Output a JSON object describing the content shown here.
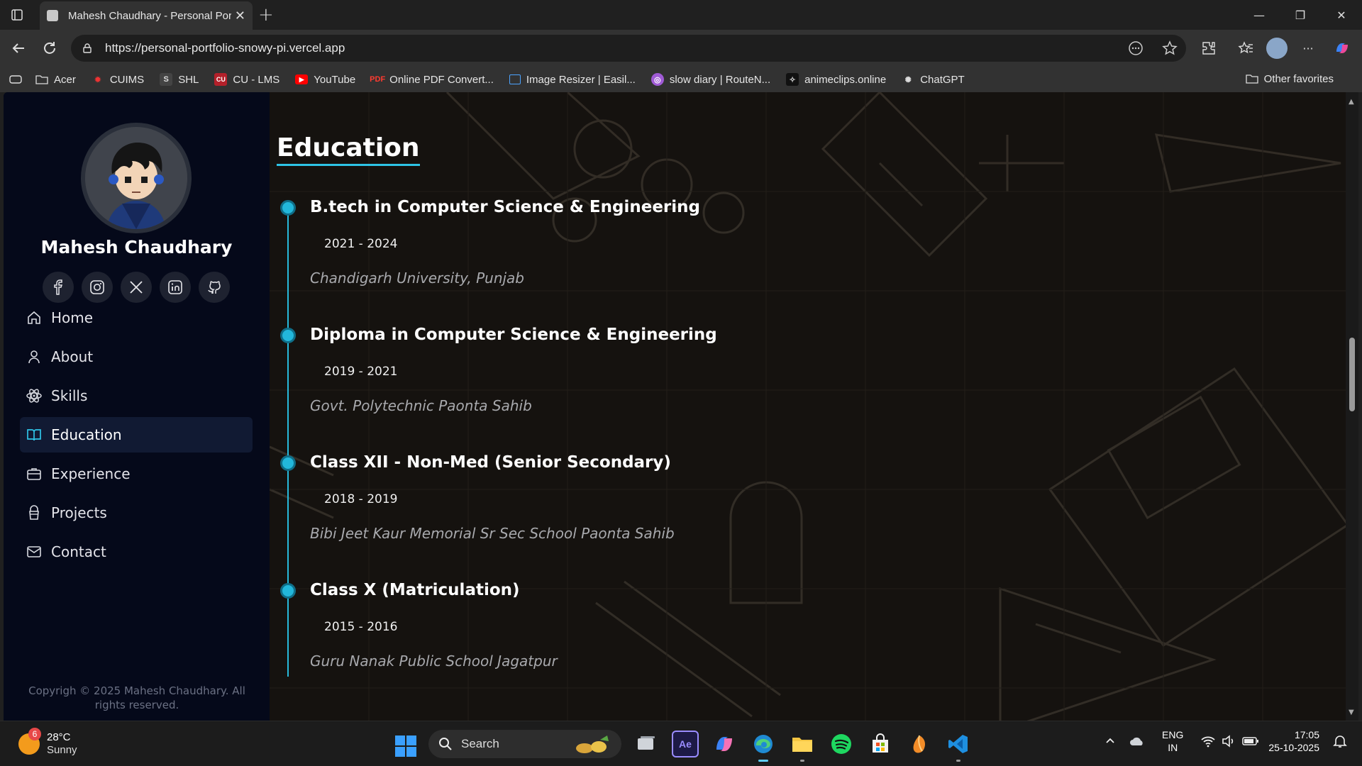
{
  "browser": {
    "tab_title": "Mahesh Chaudhary - Personal Portfolio",
    "url": "https://personal-portfolio-snowy-pi.vercel.app",
    "favorites": [
      {
        "label": "Acer",
        "icon": "folder-icon"
      },
      {
        "label": "CUIMS",
        "icon": "cuims-icon"
      },
      {
        "label": "SHL",
        "icon": "shl-icon"
      },
      {
        "label": "CU - LMS",
        "icon": "lms-icon"
      },
      {
        "label": "YouTube",
        "icon": "youtube-icon"
      },
      {
        "label": "Online PDF Convert...",
        "icon": "pdf-icon"
      },
      {
        "label": "Image Resizer | Easil...",
        "icon": "image-resizer-icon"
      },
      {
        "label": "slow diary | RouteN...",
        "icon": "routenote-icon"
      },
      {
        "label": "animeclips.online",
        "icon": "animeclips-icon"
      },
      {
        "label": "ChatGPT",
        "icon": "chatgpt-icon"
      }
    ],
    "other_favorites": "Other favorites"
  },
  "sidebar": {
    "name": "Mahesh Chaudhary",
    "socials": [
      "facebook-icon",
      "instagram-icon",
      "x-icon",
      "linkedin-icon",
      "github-icon"
    ],
    "nav": [
      {
        "label": "Home",
        "icon": "home-icon",
        "active": false
      },
      {
        "label": "About",
        "icon": "user-icon",
        "active": false
      },
      {
        "label": "Skills",
        "icon": "atom-icon",
        "active": false
      },
      {
        "label": "Education",
        "icon": "book-icon",
        "active": true
      },
      {
        "label": "Experience",
        "icon": "briefcase-icon",
        "active": false
      },
      {
        "label": "Projects",
        "icon": "projects-icon",
        "active": false
      },
      {
        "label": "Contact",
        "icon": "mail-icon",
        "active": false
      }
    ],
    "copyright": "Copyrigh © 2025 Mahesh Chaudhary. All rights reserved."
  },
  "main": {
    "title": "Education",
    "entries": [
      {
        "degree": "B.tech in Computer Science & Engineering",
        "years": "2021 - 2024",
        "institution": "Chandigarh University, Punjab"
      },
      {
        "degree": "Diploma in Computer Science & Engineering",
        "years": "2019 - 2021",
        "institution": "Govt. Polytechnic Paonta Sahib"
      },
      {
        "degree": "Class XII - Non-Med (Senior Secondary)",
        "years": "2018 - 2019",
        "institution": "Bibi Jeet Kaur Memorial Sr Sec School Paonta Sahib"
      },
      {
        "degree": "Class X (Matriculation)",
        "years": "2015 - 2016",
        "institution": "Guru Nanak Public School Jagatpur"
      }
    ]
  },
  "taskbar": {
    "weather_badge": "6",
    "temperature": "28°C",
    "condition": "Sunny",
    "search_label": "Search",
    "apps": [
      "task-view-icon",
      "after-effects-icon",
      "copilot-icon",
      "edge-icon",
      "file-explorer-icon",
      "spotify-icon",
      "store-icon",
      "fl-studio-icon",
      "vscode-icon"
    ],
    "language": "ENG",
    "region": "IN",
    "time": "17:05",
    "date": "25-10-2025"
  },
  "colors": {
    "accent": "#22b7db",
    "sidebar_bg": "#05091a",
    "active_nav_bg": "#111a33"
  }
}
